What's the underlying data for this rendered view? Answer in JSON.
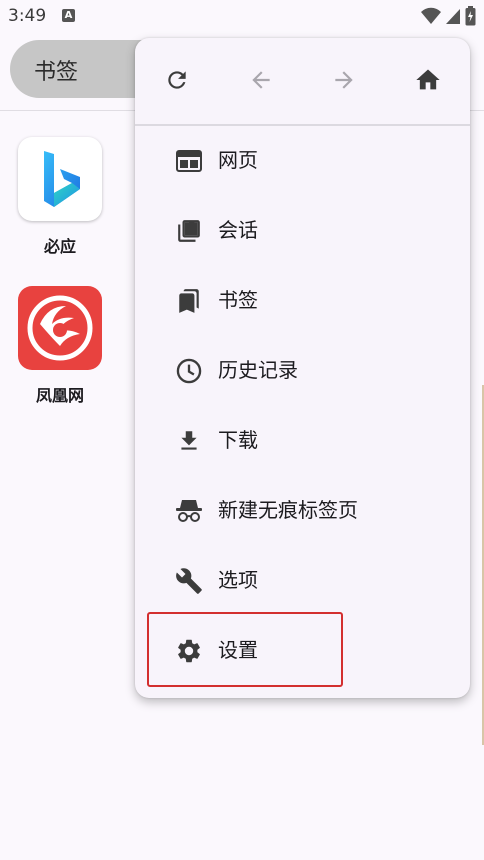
{
  "status_bar": {
    "time": "3:49",
    "notification_letter": "A"
  },
  "page": {
    "tab_title": "书签",
    "shortcuts": [
      {
        "label": "必应",
        "icon": "bing-logo-icon"
      },
      {
        "label": "凤凰网",
        "icon": "ifeng-logo-icon"
      }
    ]
  },
  "menu": {
    "nav": [
      {
        "name": "reload",
        "icon": "reload-icon",
        "enabled": true
      },
      {
        "name": "back",
        "icon": "arrow-back-icon",
        "enabled": false
      },
      {
        "name": "forward",
        "icon": "arrow-forward-icon",
        "enabled": false
      },
      {
        "name": "home",
        "icon": "home-icon",
        "enabled": true
      }
    ],
    "items": [
      {
        "label": "网页",
        "icon": "web-page-icon"
      },
      {
        "label": "会话",
        "icon": "sessions-icon"
      },
      {
        "label": "书签",
        "icon": "bookmark-icon"
      },
      {
        "label": "历史记录",
        "icon": "history-clock-icon"
      },
      {
        "label": "下载",
        "icon": "download-icon"
      },
      {
        "label": "新建无痕标签页",
        "icon": "incognito-icon"
      },
      {
        "label": "选项",
        "icon": "wrench-icon"
      },
      {
        "label": "设置",
        "icon": "gear-icon"
      }
    ],
    "highlighted_item": "设置",
    "highlight_color": "#d32f2f"
  }
}
